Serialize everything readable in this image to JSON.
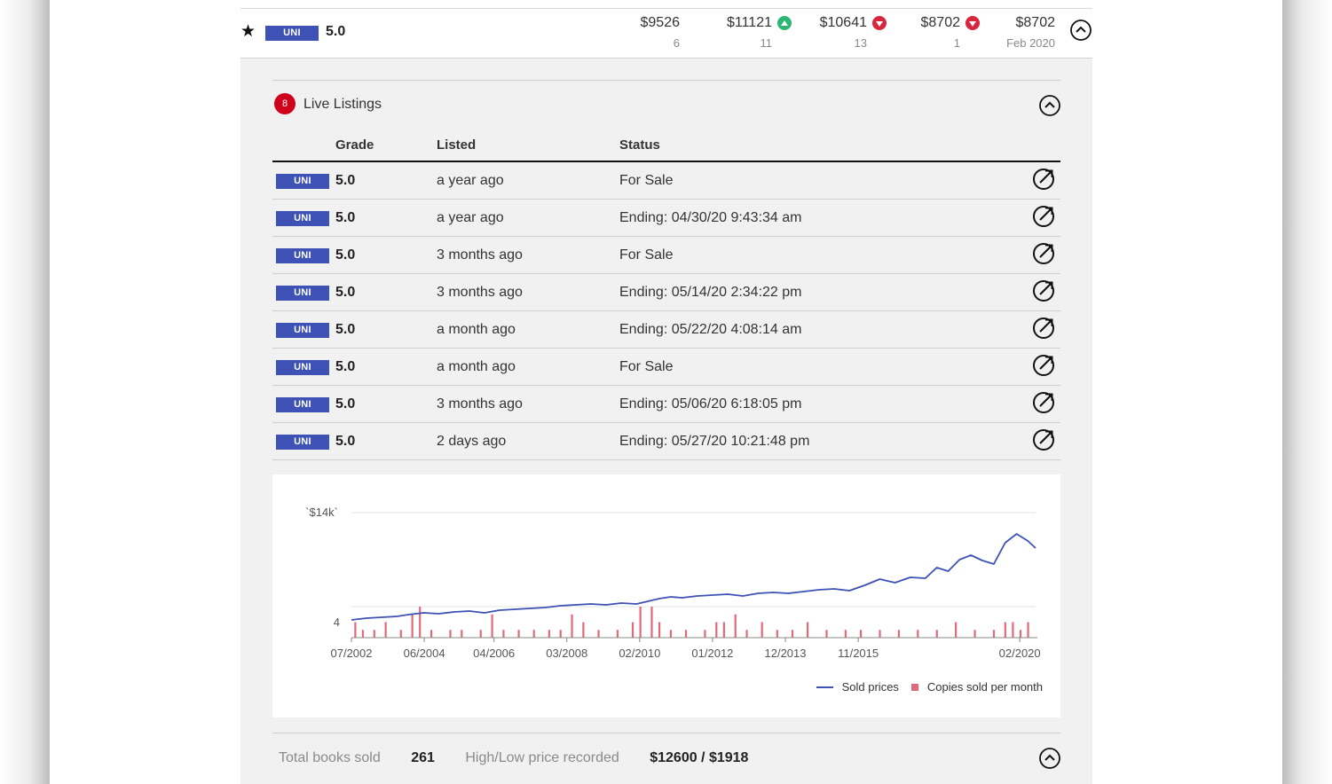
{
  "summary": {
    "badge": "UNI",
    "grade": "5.0",
    "columns": [
      {
        "price": "$9526",
        "sub": "6",
        "trend": "none"
      },
      {
        "price": "$11121",
        "sub": "11",
        "trend": "up"
      },
      {
        "price": "$10641",
        "sub": "13",
        "trend": "down"
      },
      {
        "price": "$8702",
        "sub": "1",
        "trend": "down"
      },
      {
        "price": "$8702",
        "sub": "Feb 2020",
        "trend": "none"
      }
    ]
  },
  "live_listings": {
    "count": "8",
    "title": "Live Listings",
    "headers": {
      "grade": "Grade",
      "listed": "Listed",
      "status": "Status"
    },
    "rows": [
      {
        "badge": "UNI",
        "grade": "5.0",
        "listed": "a year ago",
        "status": "For Sale"
      },
      {
        "badge": "UNI",
        "grade": "5.0",
        "listed": "a year ago",
        "status": "Ending: 04/30/20 9:43:34 am"
      },
      {
        "badge": "UNI",
        "grade": "5.0",
        "listed": "3 months ago",
        "status": "For Sale"
      },
      {
        "badge": "UNI",
        "grade": "5.0",
        "listed": "3 months ago",
        "status": "Ending: 05/14/20 2:34:22 pm"
      },
      {
        "badge": "UNI",
        "grade": "5.0",
        "listed": "a month ago",
        "status": "Ending: 05/22/20 4:08:14 am"
      },
      {
        "badge": "UNI",
        "grade": "5.0",
        "listed": "a month ago",
        "status": "For Sale"
      },
      {
        "badge": "UNI",
        "grade": "5.0",
        "listed": "3 months ago",
        "status": "Ending: 05/06/20 6:18:05 pm"
      },
      {
        "badge": "UNI",
        "grade": "5.0",
        "listed": "2 days ago",
        "status": "Ending: 05/27/20 10:21:48 pm"
      }
    ]
  },
  "chart_data": {
    "type": "line",
    "y_label_top": "`$14k`",
    "y_label_bar": "4",
    "x_ticks": [
      "07/2002",
      "06/2004",
      "04/2006",
      "03/2008",
      "02/2010",
      "01/2012",
      "12/2013",
      "11/2015",
      "02/2020"
    ],
    "x_range": [
      2002.5,
      2020.5
    ],
    "price_ylim": [
      0,
      14000
    ],
    "bars_ylim": [
      0,
      4
    ],
    "series": [
      {
        "name": "Sold prices",
        "x": [
          2002.5,
          2002.9,
          2003.3,
          2003.7,
          2004.0,
          2004.4,
          2004.8,
          2005.2,
          2005.6,
          2006.0,
          2006.4,
          2006.8,
          2007.2,
          2007.6,
          2008.0,
          2008.4,
          2008.8,
          2009.2,
          2009.6,
          2010.0,
          2010.3,
          2010.6,
          2010.9,
          2011.2,
          2011.6,
          2012.0,
          2012.4,
          2012.8,
          2013.2,
          2013.6,
          2014.0,
          2014.4,
          2014.8,
          2015.2,
          2015.6,
          2016.0,
          2016.4,
          2016.8,
          2017.2,
          2017.6,
          2017.9,
          2018.2,
          2018.5,
          2018.8,
          2019.1,
          2019.4,
          2019.7,
          2020.0,
          2020.3,
          2020.5
        ],
        "values": [
          1900,
          2100,
          2200,
          2300,
          2500,
          2700,
          2600,
          2800,
          2900,
          2700,
          3000,
          3100,
          3200,
          3300,
          3500,
          3600,
          3700,
          3600,
          3800,
          3700,
          4000,
          4300,
          4500,
          4400,
          4600,
          4700,
          4800,
          4600,
          4900,
          5000,
          4900,
          5100,
          5300,
          5400,
          5200,
          5800,
          6500,
          6100,
          6700,
          6600,
          7800,
          7400,
          8700,
          9200,
          8600,
          8200,
          10600,
          11600,
          10800,
          10000
        ]
      },
      {
        "name": "Copies sold per month",
        "x": [
          2002.6,
          2002.8,
          2003.1,
          2003.4,
          2003.8,
          2004.1,
          2004.3,
          2004.6,
          2005.1,
          2005.4,
          2005.9,
          2006.2,
          2006.5,
          2006.9,
          2007.3,
          2007.7,
          2008.0,
          2008.3,
          2008.6,
          2009.0,
          2009.5,
          2009.9,
          2010.1,
          2010.4,
          2010.6,
          2010.9,
          2011.3,
          2011.8,
          2012.1,
          2012.3,
          2012.6,
          2012.9,
          2013.3,
          2013.7,
          2014.1,
          2014.5,
          2015.0,
          2015.5,
          2015.9,
          2016.4,
          2016.9,
          2017.4,
          2017.9,
          2018.4,
          2018.9,
          2019.4,
          2019.7,
          2019.9,
          2020.1,
          2020.3
        ],
        "values": [
          2,
          1,
          1,
          2,
          1,
          3,
          4,
          1,
          1,
          1,
          1,
          3,
          1,
          1,
          1,
          1,
          1,
          3,
          2,
          1,
          1,
          2,
          4,
          4,
          2,
          1,
          1,
          1,
          2,
          2,
          3,
          1,
          2,
          1,
          1,
          2,
          1,
          1,
          1,
          1,
          1,
          1,
          1,
          2,
          1,
          1,
          2,
          2,
          1,
          2
        ]
      }
    ],
    "legend": [
      "Sold prices",
      "Copies sold per month"
    ],
    "legend_position": "bottom-right",
    "colors": {
      "price": "#3e51b5",
      "bars": "#e06a7a"
    }
  },
  "footer": {
    "total_label": "Total books sold",
    "total_value": "261",
    "hilo_label": "High/Low price recorded",
    "hilo_value": "$12600 / $1918"
  },
  "icons": {
    "favorite": "star-icon",
    "collapse": "chevron-up-icon",
    "open": "external-link-icon"
  }
}
